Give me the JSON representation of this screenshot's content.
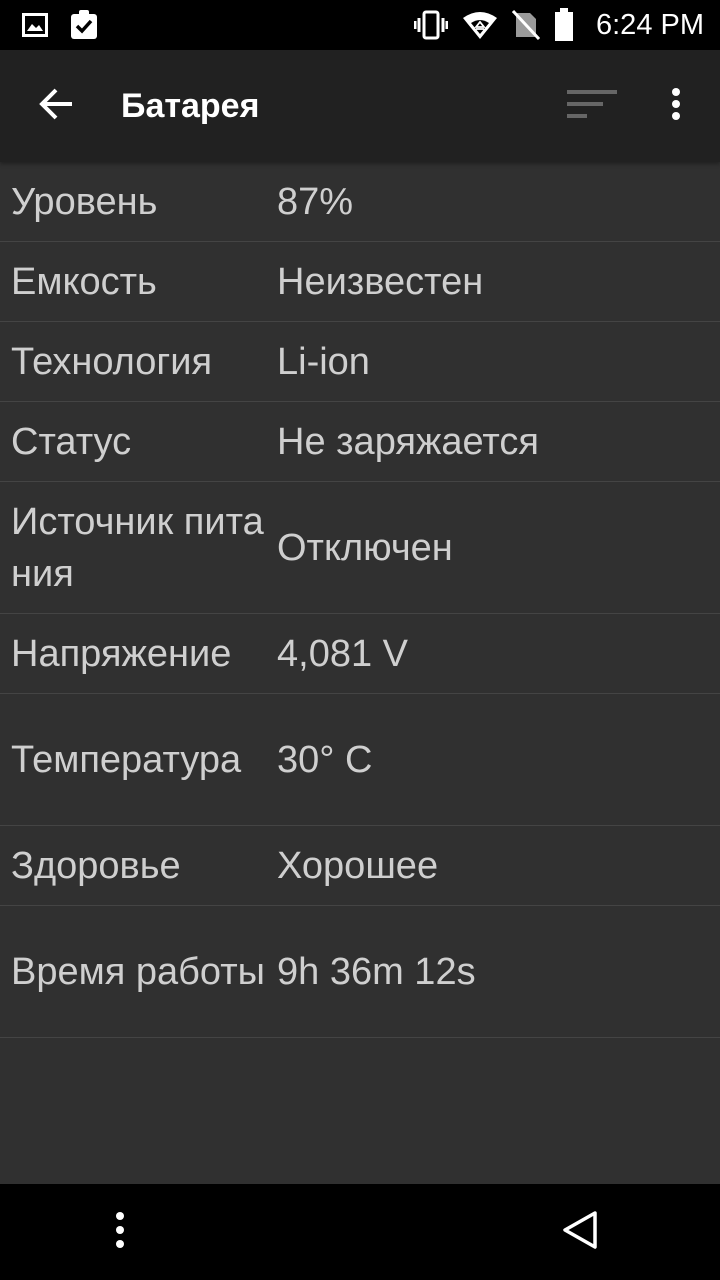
{
  "status_bar": {
    "time": "6:24 PM",
    "left_icons": [
      "image-icon",
      "clipboard-check-icon"
    ],
    "right_icons": [
      "vibrate-icon",
      "wifi-icon",
      "no-sim-icon",
      "battery-icon"
    ]
  },
  "app_bar": {
    "title": "Батарея",
    "back_icon": "arrow-left-icon",
    "sort_icon": "sort-icon",
    "more_icon": "more-vert-icon"
  },
  "battery_info": [
    {
      "label": "Уровень",
      "value": "87%"
    },
    {
      "label": "Емкость",
      "value": "Неизвестен"
    },
    {
      "label": "Технология",
      "value": "Li-ion"
    },
    {
      "label": "Статус",
      "value": "Не заряжается"
    },
    {
      "label": "Источник питания",
      "value": "Отключен"
    },
    {
      "label": "Напряжение",
      "value": "4,081 V"
    },
    {
      "label": "Температура",
      "value": "30° C"
    },
    {
      "label": "Здоровье",
      "value": "Хорошее"
    },
    {
      "label": "Время работы",
      "value": "9h 36m 12s"
    }
  ],
  "nav_bar": {
    "menu_icon": "more-vert-icon",
    "back_icon": "triangle-back-icon"
  },
  "colors": {
    "background": "#303030",
    "app_bar": "#212121",
    "status_bar": "#000000",
    "text": "#cfcfcf",
    "divider": "#444444"
  }
}
